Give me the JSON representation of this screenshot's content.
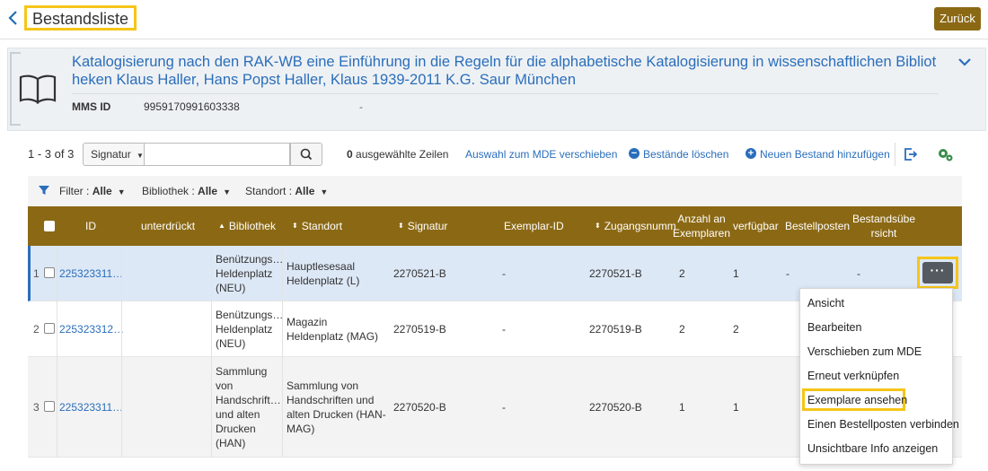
{
  "header": {
    "title": "Bestandsliste",
    "back_label": "Zurück"
  },
  "record": {
    "title": "Katalogisierung nach den RAK-WB eine Einführung in die Regeln für die alphabetische Katalogisierung in wissenschaftlichen Bibliot heken Klaus Haller, Hans Popst Haller, Klaus 1939-2011 K.G. Saur München",
    "mms_label": "MMS ID",
    "mms_value": "9959170991603338",
    "extra_value": "-"
  },
  "toolbar": {
    "count": "1 - 3 of 3",
    "search_field": "Signatur",
    "search_value": "",
    "selected_count": "0",
    "selected_label": "ausgewählte Zeilen",
    "move_label": "Auswahl zum MDE verschieben",
    "delete_label": "Bestände löschen",
    "add_label": "Neuen Bestand hinzufügen"
  },
  "filters": [
    {
      "label": "Filter :",
      "value": "Alle"
    },
    {
      "label": "Bibliothek :",
      "value": "Alle"
    },
    {
      "label": "Standort :",
      "value": "Alle"
    }
  ],
  "table": {
    "headers": {
      "id": "ID",
      "suppressed": "unterdrückt",
      "library": "Bibliothek",
      "location": "Standort",
      "call_number": "Signatur",
      "item_id": "Exemplar-ID",
      "accession": "Zugangsnumm",
      "num_items": "Anzahl an Exemplaren",
      "available": "verfügbar",
      "order_line": "Bestellposten",
      "summary": "Bestandsübe rsicht"
    },
    "rows": [
      {
        "num": "1",
        "id": "225323311…",
        "suppressed": "",
        "library": "Benützungs… Heldenplatz (NEU)",
        "location": "Hauptlesesaal Heldenplatz (L)",
        "call_number": "2270521-B",
        "item_id": "-",
        "accession": "2270521-B",
        "num_items": "2",
        "available": "1",
        "order_line": "-",
        "summary": "-"
      },
      {
        "num": "2",
        "id": "225323312…",
        "suppressed": "",
        "library": "Benützungs… Heldenplatz (NEU)",
        "location": "Magazin Heldenplatz (MAG)",
        "call_number": "2270519-B",
        "item_id": "-",
        "accession": "2270519-B",
        "num_items": "2",
        "available": "2",
        "order_line": "",
        "summary": ""
      },
      {
        "num": "3",
        "id": "225323311…",
        "suppressed": "",
        "library": "Sammlung von Handschrift… und alten Drucken (HAN)",
        "location": "Sammlung von Handschriften und alten Drucken (HAN-MAG)",
        "call_number": "2270520-B",
        "item_id": "-",
        "accession": "2270520-B",
        "num_items": "1",
        "available": "1",
        "order_line": "",
        "summary": ""
      }
    ]
  },
  "row_menu": {
    "items": [
      "Ansicht",
      "Bearbeiten",
      "Verschieben zum MDE",
      "Erneut verknüpfen",
      "Exemplare ansehen",
      "Einen Bestellposten verbinden",
      "Unsichtbare Info anzeigen"
    ]
  },
  "colors": {
    "accent": "#2a6ebb",
    "table_header": "#8b6914",
    "highlight": "#f5c518"
  }
}
